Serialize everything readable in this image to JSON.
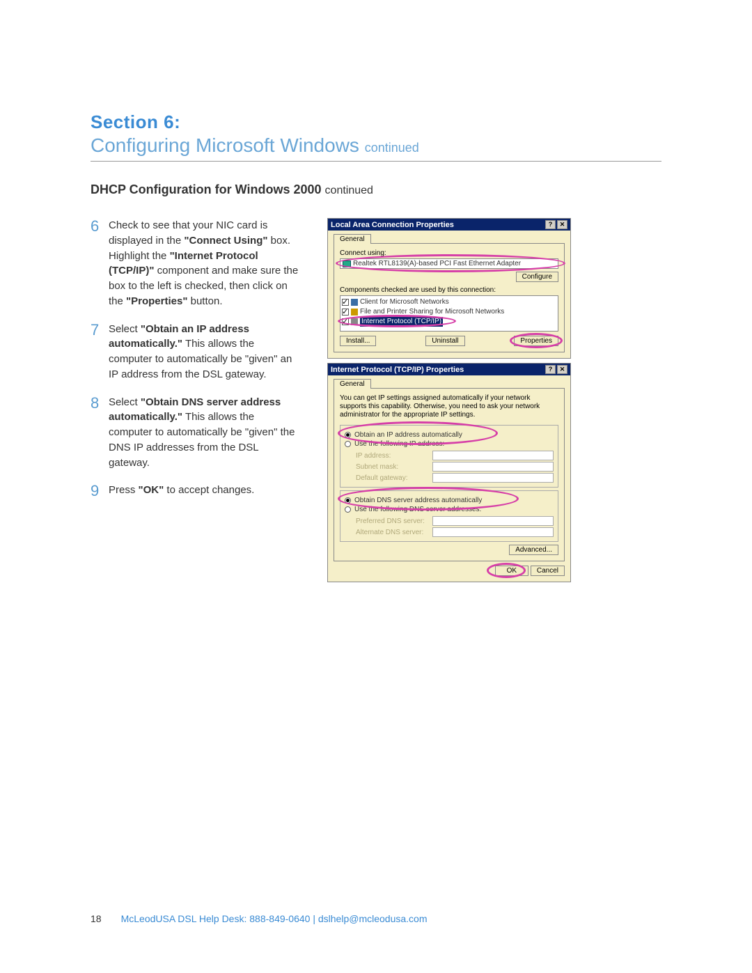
{
  "heading": {
    "section_label": "Section 6:",
    "title_main": "Configuring Microsoft Windows",
    "title_cont": "continued"
  },
  "subheading": {
    "main": "DHCP Configuration for Windows 2000",
    "cont": "continued"
  },
  "steps": [
    {
      "num": "6",
      "pre": "Check to see that your NIC card is displayed in the ",
      "b1": "\"Connect Using\"",
      "mid1": " box. Highlight the ",
      "b2": "\"Internet Protocol (TCP/IP)\"",
      "mid2": " component and make sure the box to the left is checked, then click on the ",
      "b3": "\"Properties\"",
      "post": " button."
    },
    {
      "num": "7",
      "pre": "Select ",
      "b1": "\"Obtain an IP address automatically.\"",
      "mid1": " This allows the computer to automatically be \"given\" an IP address from the DSL gateway.",
      "b2": "",
      "mid2": "",
      "b3": "",
      "post": ""
    },
    {
      "num": "8",
      "pre": "Select ",
      "b1": "\"Obtain DNS server address automatically.\"",
      "mid1": " This allows the computer to automatically be \"given\" the DNS IP addresses from the DSL gateway.",
      "b2": "",
      "mid2": "",
      "b3": "",
      "post": ""
    },
    {
      "num": "9",
      "pre": "Press ",
      "b1": "\"OK\"",
      "mid1": " to accept changes.",
      "b2": "",
      "mid2": "",
      "b3": "",
      "post": ""
    }
  ],
  "dialog1": {
    "title": "Local Area Connection Properties",
    "tab": "General",
    "connect_label": "Connect using:",
    "nic": "Realtek RTL8139(A)-based PCI Fast Ethernet Adapter",
    "configure": "Configure",
    "components_label": "Components checked are used by this connection:",
    "items": {
      "i0": "Client for Microsoft Networks",
      "i1": "File and Printer Sharing for Microsoft Networks",
      "i2": "Internet Protocol (TCP/IP)"
    },
    "install": "Install...",
    "uninstall": "Uninstall",
    "properties": "Properties"
  },
  "dialog2": {
    "title": "Internet Protocol (TCP/IP) Properties",
    "tab": "General",
    "desc": "You can get IP settings assigned automatically if your network supports this capability. Otherwise, you need to ask your network administrator for the appropriate IP settings.",
    "r1": "Obtain an IP address automatically",
    "r2": "Use the following IP address:",
    "f_ip": "IP address:",
    "f_mask": "Subnet mask:",
    "f_gw": "Default gateway:",
    "r3": "Obtain DNS server address automatically",
    "r4": "Use the following DNS server addresses:",
    "f_pdns": "Preferred DNS server:",
    "f_adns": "Alternate DNS server:",
    "advanced": "Advanced...",
    "ok": "OK",
    "cancel": "Cancel"
  },
  "footer": {
    "page": "18",
    "helpdesk": "McLeodUSA DSL Help Desk:",
    "phone": "888-849-0640",
    "sep": "|",
    "email": "dslhelp@mcleodusa.com"
  }
}
